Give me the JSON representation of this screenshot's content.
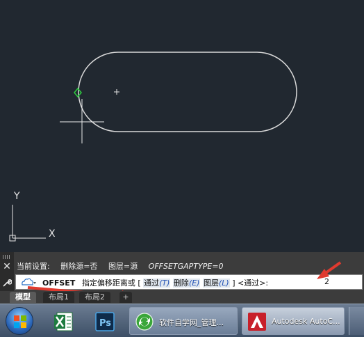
{
  "drawing": {
    "ucs": {
      "y_label": "Y",
      "x_label": "X"
    }
  },
  "command_history": {
    "label": "当前设置:",
    "erase_source": "删除源=否",
    "layer": "图层=源",
    "gaptype": "OFFSETGAPTYPE=0"
  },
  "command_line": {
    "command": "OFFSET",
    "prompt": "指定偏移距离或",
    "open_bracket": "[",
    "options": [
      {
        "label": "通过",
        "key": "(T)"
      },
      {
        "label": "删除",
        "key": "(E)"
      },
      {
        "label": "图层",
        "key": "(L)"
      }
    ],
    "close_bracket": "]",
    "default": "<通过>:",
    "value": "2"
  },
  "layout_tabs": {
    "model": "模型",
    "layout1": "布局1",
    "layout2": "布局2",
    "add": "+"
  },
  "taskbar": {
    "browser_label": "软件自学网_管理...",
    "autocad_label": "Autodesk AutoC..."
  },
  "colors": {
    "canvas": "#212830",
    "grip": "#2ecc40",
    "arrow": "#e03a2f",
    "option_key": "#1f4fb5"
  }
}
